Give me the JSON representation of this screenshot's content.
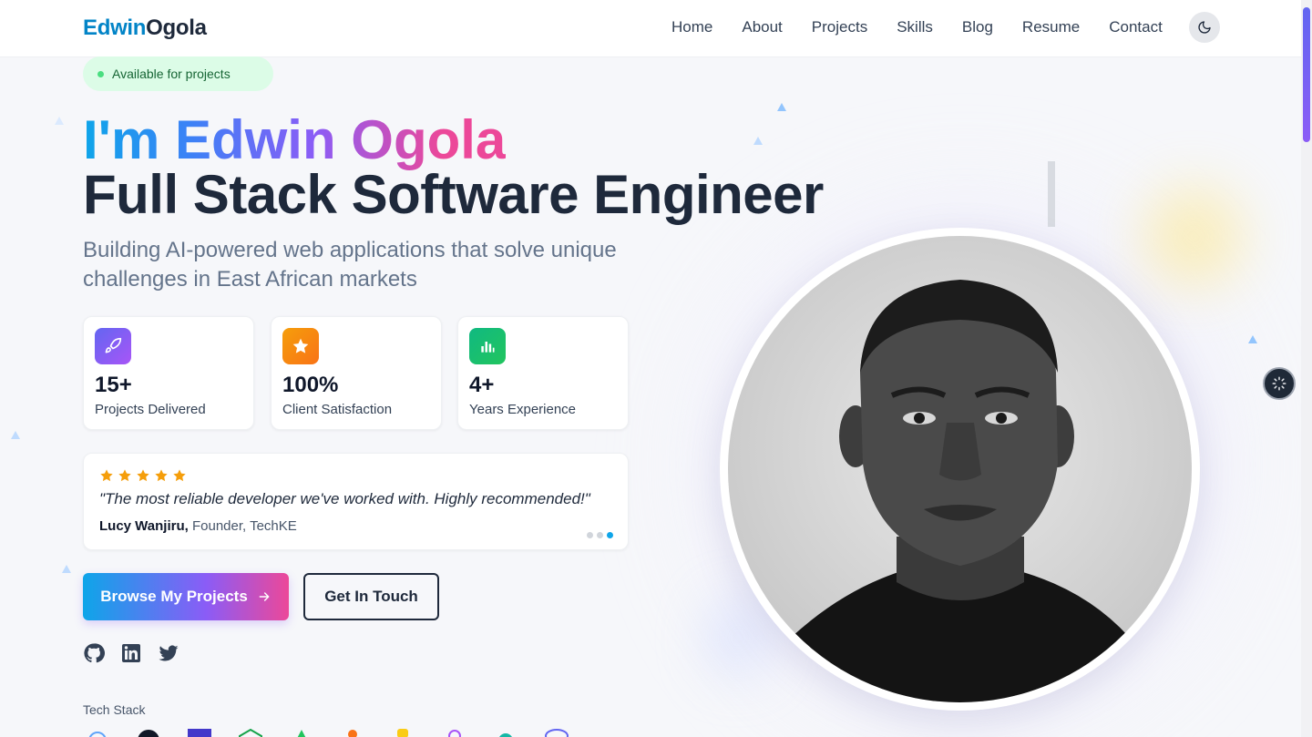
{
  "brand": {
    "first": "Edwin",
    "last": "Ogola"
  },
  "nav": {
    "items": [
      "Home",
      "About",
      "Projects",
      "Skills",
      "Blog",
      "Resume",
      "Contact"
    ]
  },
  "hero": {
    "badge": "Available for projects",
    "name_line": "I'm Edwin Ogola",
    "role_line": "Full Stack Software Engineer",
    "subtitle": "Building AI-powered web applications that solve unique challenges in East African markets"
  },
  "stats": [
    {
      "value": "15+",
      "label": "Projects Delivered",
      "icon": "rocket-icon",
      "color": "#8b5cf6"
    },
    {
      "value": "100%",
      "label": "Client Satisfaction",
      "icon": "star-icon",
      "color": "#f97316"
    },
    {
      "value": "4+",
      "label": "Years Experience",
      "icon": "chart-icon",
      "color": "#10b981"
    }
  ],
  "testimonial": {
    "rating": 5,
    "quote": "\"The most reliable developer we've worked with. Highly recommended!\"",
    "author": "Lucy Wanjiru,",
    "role": "Founder, TechKE",
    "slide_count": 3,
    "active_slide": 3
  },
  "buttons": {
    "primary": "Browse My Projects",
    "secondary": "Get In Touch"
  },
  "social": [
    "github-icon",
    "linkedin-icon",
    "twitter-icon"
  ],
  "tech_stack": {
    "label": "Tech Stack"
  },
  "colors": {
    "accent_blue": "#0ea5e9",
    "accent_purple": "#8b5cf6",
    "accent_pink": "#ec4899",
    "text_dark": "#1e293b"
  }
}
